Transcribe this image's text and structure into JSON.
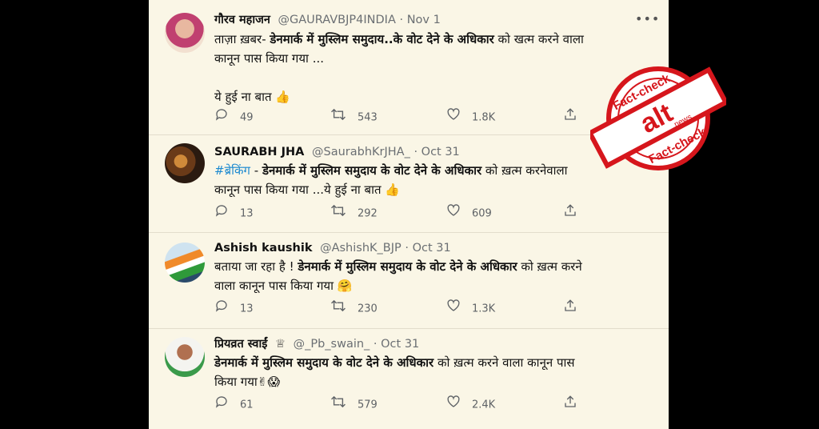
{
  "tweets": [
    {
      "name": "गौरव महाजन",
      "handle": "@GAURAVBJP4INDIA",
      "sep": "·",
      "date": "Nov 1",
      "lines": [
        [
          {
            "t": "ताज़ा ख़बर- ",
            "b": false
          },
          {
            "t": "डेनमार्क में मुस्लिम समुदाय..के वोट देने के अधिकार",
            "b": true
          },
          {
            "t": " को खत्म करने वाला",
            "b": false
          }
        ],
        [
          {
            "t": "कानून पास किया गया ...",
            "b": false
          }
        ],
        [],
        [
          {
            "t": "ये हुई ना बात ",
            "b": false
          },
          {
            "t": "👍",
            "b": false
          }
        ]
      ],
      "replies": "49",
      "retweets": "543",
      "likes": "1.8K"
    },
    {
      "name": "SAURABH JHA",
      "handle": "@SaurabhKrJHA_",
      "sep": "·",
      "date": "Oct 31",
      "lines": [
        [
          {
            "t": "#ब्रेकिंग",
            "b": false,
            "hash": true
          },
          {
            "t": " - ",
            "b": false
          },
          {
            "t": "डेनमार्क में मुस्लिम समुदाय के वोट देने के अधिकार",
            "b": true
          },
          {
            "t": " को ख़त्म करनेवाला",
            "b": false
          }
        ],
        [
          {
            "t": "कानून पास किया गया ...ये हुई ना बात ",
            "b": false
          },
          {
            "t": "👍",
            "b": false
          }
        ]
      ],
      "replies": "13",
      "retweets": "292",
      "likes": "609"
    },
    {
      "name": "Ashish kaushik",
      "handle": "@AshishK_BJP",
      "sep": "·",
      "date": "Oct 31",
      "lines": [
        [
          {
            "t": "बताया जा रहा है ! ",
            "b": false
          },
          {
            "t": "डेनमार्क में मुस्लिम समुदाय के वोट देने के अधिकार",
            "b": true
          },
          {
            "t": " को ख़त्म करने",
            "b": false
          }
        ],
        [
          {
            "t": "वाला कानून पास किया गया ",
            "b": false
          },
          {
            "t": "🤗",
            "b": false
          }
        ]
      ],
      "replies": "13",
      "retweets": "230",
      "likes": "1.3K"
    },
    {
      "name": "प्रियव्रत स्वाईं",
      "badge": "♕",
      "handle": "@_Pb_swain_",
      "sep": "·",
      "date": "Oct 31",
      "lines": [
        [
          {
            "t": "डेनमार्क में मुस्लिम समुदाय के वोट देने के अधिकार",
            "b": true
          },
          {
            "t": " को ख़त्म करने वाला कानून पास",
            "b": false
          }
        ],
        [
          {
            "t": "किया गया",
            "b": false
          },
          {
            "t": "✌😱",
            "b": false
          }
        ]
      ],
      "replies": "61",
      "retweets": "579",
      "likes": "2.4K"
    }
  ],
  "more_icon": "more-dots-icon",
  "stamp": {
    "top_text": "Fact-check",
    "bottom_text": "Fact-check",
    "logo_text": "alt",
    "logo_sub": "news",
    "red": "#d6161c"
  },
  "colors": {
    "feed_bg": "#faf6e6",
    "hashtag": "#1d8ad0",
    "text": "#111111",
    "muted": "#6b6f73"
  }
}
